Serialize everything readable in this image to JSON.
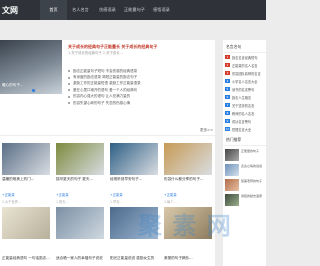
{
  "nav": {
    "logo": "文网",
    "items": [
      "首页",
      "名人名言",
      "伤感语录",
      "正能量句子",
      "感悟语录"
    ],
    "active_index": 0
  },
  "hero": {
    "caption": "暖心的句子…",
    "slides_total": 3,
    "slide_active": 0
  },
  "top": {
    "headline": "关于成长的经典句子正能量长 关于成长的经典句子",
    "summary": "1.关于成长的经典句子 2.关于成长…"
  },
  "list": [
    "励志正能量句子短句 不会伤感的经典语录",
    "有深度的励志语录 简短正能量的励志句子",
    "激励工作的正能量短语 激励工作正能量语录",
    "爱在心里口难开的语句 爱一个人的经典句",
    "形容内心强大的语句 让人充满力量的",
    "形容失望心碎的句子 失恋的伤感心情"
  ],
  "more_label": "更多>>",
  "cards": [
    {
      "title": "温暖的唯美上热门...",
      "tag": "+正能量",
      "desc": "1.大千世界...",
      "color": "#5a6e86"
    },
    {
      "title": "描写夏天的句子 夏天...",
      "tag": "+正能量",
      "desc": "1.夏天...",
      "color": "#7d8a3e"
    },
    {
      "title": "经常听到早安句子...",
      "tag": "+正能量",
      "desc": "1.早安...",
      "color": "#2e5f85"
    },
    {
      "title": "形容什么都分享的句子...",
      "tag": "+正能量",
      "desc": "1.每个...",
      "color": "#c79a55"
    }
  ],
  "bottom_titles": [
    "正能量经典语句 一句话励志...",
    "适合晒一家人的幸福句子说说",
    "阳光正能量说说 激励女生的",
    "美丽的句子摘抄..."
  ],
  "sidebar": {
    "head1": "名言名句",
    "ranked": [
      "励志名言经典短句",
      "正能量的名人名言",
      "形容团队精神的名言",
      "小学名人名言大全",
      "读书的名言警句",
      "励志人生格言",
      "关于坚持的名言",
      "教师的名人名言",
      "成功名言警句",
      "哲理名言大全"
    ],
    "head2": "热门推荐",
    "picks": [
      "正能量的句子",
      "表达心情的说说",
      "赞美老师的句子",
      "简短的励志语录"
    ]
  },
  "watermark": "聚 素 网"
}
